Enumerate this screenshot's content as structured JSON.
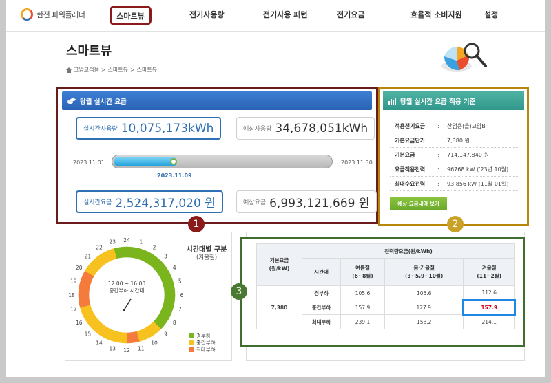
{
  "app": {
    "logo_text": "한전 파워플래너"
  },
  "nav": {
    "active": "스마트뷰",
    "items": [
      "전기사용량",
      "전기사용 패턴",
      "전기요금",
      "효율적 소비지원",
      "설정"
    ]
  },
  "page": {
    "title": "스마트뷰",
    "breadcrumb": [
      "고압고객용",
      "스마트뷰",
      "스마트뷰"
    ]
  },
  "realtime": {
    "header": "당월 실시간 요금",
    "usage_label": "실시간사용량",
    "usage_value": "10,075,173kWh",
    "forecast_usage_label": "예상사용량",
    "forecast_usage_value": "34,678,051kWh",
    "start_date": "2023.11.01",
    "end_date": "2023.11.30",
    "current_date": "2023.11.09",
    "progress_fraction": 0.29,
    "fee_label": "실시간요금",
    "fee_value": "2,524,317,020 원",
    "forecast_fee_label": "예상요금",
    "forecast_fee_value": "6,993,121,669 원"
  },
  "standard": {
    "header": "당월 실시간 요금 적용 기준",
    "rows": [
      {
        "key": "적용전기요금",
        "value": "산업용(을)고압B"
      },
      {
        "key": "기본요금단가",
        "value": "7,380 원"
      },
      {
        "key": "기본요금",
        "value": "714,147,840 원"
      },
      {
        "key": "요금적용전력",
        "value": "96768 kW ('23년 10월)"
      },
      {
        "key": "최대수요전력",
        "value": "93,856 kW (11월 01일)"
      }
    ],
    "button_label": "예상 요금내역 보기"
  },
  "markers": [
    "1",
    "2",
    "3"
  ],
  "timeband": {
    "title": "시간대별 구분",
    "season": "(겨울철)",
    "center_time": "12:00 ~ 16:00",
    "center_label": "중간부하 시간대",
    "hour_labels": [
      "24",
      "1",
      "2",
      "3",
      "4",
      "5",
      "6",
      "7",
      "8",
      "9",
      "10",
      "11",
      "12",
      "13",
      "14",
      "15",
      "16",
      "17",
      "18",
      "19",
      "20",
      "21",
      "22",
      "23"
    ],
    "hour_bands": [
      "light",
      "light",
      "light",
      "light",
      "light",
      "light",
      "light",
      "light",
      "light",
      "mid",
      "mid",
      "max",
      "mid",
      "mid",
      "mid",
      "mid",
      "mid",
      "max",
      "max",
      "max",
      "mid",
      "mid",
      "mid",
      "light"
    ],
    "legend": [
      {
        "label": "경부하",
        "color": "#7ab51d"
      },
      {
        "label": "중간부하",
        "color": "#f7c11f"
      },
      {
        "label": "최대부하",
        "color": "#f47b3c"
      }
    ]
  },
  "rate_table": {
    "header_base": "기본요금\n(원/kW)",
    "header_energy": "전력량요금(원/kWh)",
    "header_band": "시간대",
    "seasons": [
      "여름철\n(6~8월)",
      "봄·가을철\n(3~5,9~10월)",
      "겨울철\n(11~2월)"
    ],
    "base_value": "7,380",
    "rows": [
      {
        "band": "경부하",
        "values": [
          "105.6",
          "105.6",
          "112.6"
        ]
      },
      {
        "band": "중간부하",
        "values": [
          "157.9",
          "127.9",
          "157.9"
        ]
      },
      {
        "band": "최대부하",
        "values": [
          "239.1",
          "158.2",
          "214.1"
        ]
      }
    ]
  }
}
